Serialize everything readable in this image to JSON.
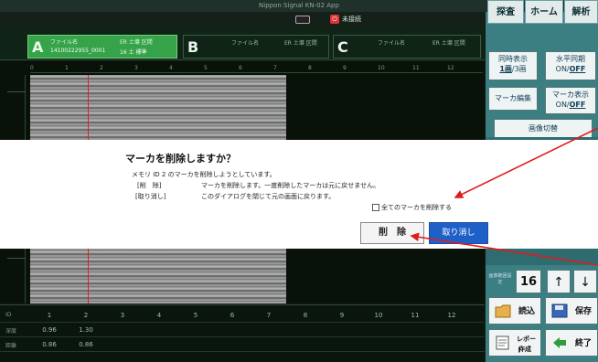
{
  "window": {
    "title": "Nippon Signal KN-02 App"
  },
  "toolbar": {
    "power_label": "未接続"
  },
  "channels": {
    "a": {
      "letter": "A",
      "file_label": "ファイル名",
      "cols": "ER  土壌  区間",
      "file_value": "14100222955_0001",
      "vals": "16  土  標準"
    },
    "b": {
      "letter": "B",
      "file_label": "ファイル名",
      "cols": "ER  土壌  区間"
    },
    "c": {
      "letter": "C",
      "file_label": "ファイル名",
      "cols": "ER  土壌  区間"
    }
  },
  "scale": [
    "0",
    "1",
    "2",
    "3",
    "4",
    "5",
    "6",
    "7",
    "8",
    "9",
    "10",
    "11",
    "12"
  ],
  "bottom_table": {
    "row_labels": [
      "ID",
      "深度",
      "距離"
    ],
    "ids": [
      "1",
      "2",
      "3",
      "4",
      "5",
      "6",
      "7",
      "8",
      "9",
      "10",
      "11",
      "12"
    ],
    "depth": [
      "0.96",
      "1.30"
    ],
    "dist": [
      "0.86",
      "0.86"
    ]
  },
  "side": {
    "tabs": [
      "探査",
      "ホーム",
      "解析"
    ],
    "btn_same_display_top": "同時表示",
    "btn_same_display_val": "1画",
    "btn_same_display_rest": "/3画",
    "btn_hsync_top": "水平同期",
    "btn_hsync_val": "ON/",
    "btn_hsync_off": "OFF",
    "btn_marker_edit": "マーカ編集",
    "btn_marker_display_top": "マーカ表示",
    "btn_marker_display_val": "ON/",
    "btn_marker_display_off": "OFF",
    "btn_image_switch": "画像切替",
    "num_label": "画像範囲設定",
    "num_value": "16",
    "up_arrow": "↑",
    "down_arrow": "↓",
    "load": "読込",
    "save": "保存",
    "report_top": "レポート",
    "report_bottom": "作成",
    "exit": "終了"
  },
  "dialog": {
    "title": "マーカを削除しますか？",
    "line1": "メモリ ID 2 のマーカを削除しようとしています。",
    "line2_key": "[削　除]",
    "line2_val": "マーカを削除します。一度削除したマーカは元に戻せません。",
    "line3_key": "[取り消し]",
    "line3_val": "このダイアログを閉じて元の画面に戻ります。",
    "checkbox_label": "全てのマーカを削除する",
    "delete_button": "削　除",
    "cancel_button": "取り消し"
  },
  "colors": {
    "accent_blue": "#1f5fc8",
    "arrow_red": "#e01b1b",
    "channel_green": "#36a34a",
    "side_teal": "#3b7f83"
  }
}
